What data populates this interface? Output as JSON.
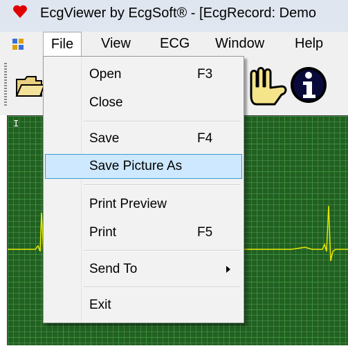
{
  "window": {
    "title": "EcgViewer by EcgSoft® - [EcgRecord: Demo"
  },
  "menubar": {
    "items": [
      "File",
      "View",
      "ECG",
      "Window",
      "Help"
    ]
  },
  "ecg": {
    "lead_label": "I",
    "trace_color": "#e8e800",
    "grid_color": "#206020"
  },
  "file_menu": {
    "open": {
      "label": "Open",
      "shortcut": "F3"
    },
    "close": {
      "label": "Close"
    },
    "save": {
      "label": "Save",
      "shortcut": "F4"
    },
    "save_picture_as": {
      "label": "Save Picture As"
    },
    "print_preview": {
      "label": "Print Preview"
    },
    "print": {
      "label": "Print",
      "shortcut": "F5"
    },
    "send_to": {
      "label": "Send To"
    },
    "exit": {
      "label": "Exit"
    }
  },
  "icons": [
    "heart-icon",
    "app-icon",
    "open-folder-icon",
    "hand-icon",
    "info-icon",
    "submenu-arrow-icon"
  ],
  "colors": {
    "highlight": "#cde8ff",
    "highlight_border": "#3c9dd0",
    "title_bar": "#dfe6ef"
  }
}
